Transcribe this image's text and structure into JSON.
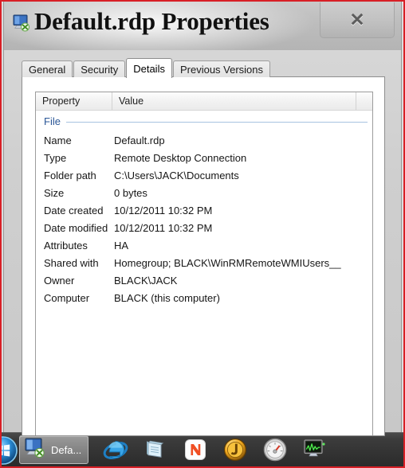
{
  "window": {
    "title": "Default.rdp Properties",
    "icon": "remote-desktop-icon",
    "close_label": "✕"
  },
  "tabs": [
    {
      "label": "General",
      "active": false
    },
    {
      "label": "Security",
      "active": false
    },
    {
      "label": "Details",
      "active": true
    },
    {
      "label": "Previous Versions",
      "active": false
    }
  ],
  "details": {
    "columns": [
      "Property",
      "Value",
      ""
    ],
    "group_label": "File",
    "rows": [
      {
        "property": "Name",
        "value": "Default.rdp"
      },
      {
        "property": "Type",
        "value": "Remote Desktop Connection"
      },
      {
        "property": "Folder path",
        "value": "C:\\Users\\JACK\\Documents"
      },
      {
        "property": "Size",
        "value": "0 bytes"
      },
      {
        "property": "Date created",
        "value": "10/12/2011 10:32 PM"
      },
      {
        "property": "Date modified",
        "value": "10/12/2011 10:32 PM"
      },
      {
        "property": "Attributes",
        "value": "HA"
      },
      {
        "property": "Shared with",
        "value": "Homegroup; BLACK\\WinRMRemoteWMIUsers__"
      },
      {
        "property": "Owner",
        "value": "BLACK\\JACK"
      },
      {
        "property": "Computer",
        "value": "BLACK (this computer)"
      }
    ]
  },
  "taskbar": {
    "start_button": "start-orb-icon",
    "active_task": {
      "label": "Defa...",
      "icon": "remote-desktop-icon"
    },
    "pinned": [
      {
        "name": "internet-explorer-icon"
      },
      {
        "name": "notepad-icon"
      },
      {
        "name": "nitro-pdf-icon"
      },
      {
        "name": "java-icon"
      },
      {
        "name": "speedometer-icon"
      },
      {
        "name": "resource-monitor-icon"
      }
    ]
  },
  "colors": {
    "accent_blue": "#2b5797",
    "capture_border": "#d81f26",
    "taskbar": "#333333"
  }
}
